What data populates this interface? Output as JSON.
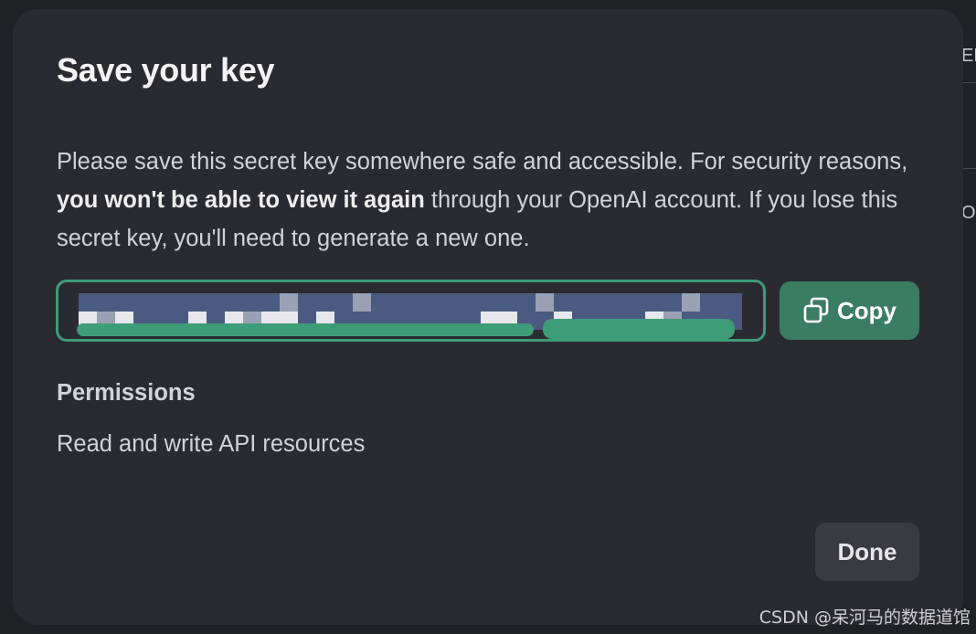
{
  "background": {
    "edge_glyph_top": "ED",
    "edge_glyph_mid": "O"
  },
  "dialog": {
    "title": "Save your key",
    "description_part1": "Please save this secret key somewhere safe and accessible. For security reasons, ",
    "description_bold": "you won't be able to view it again",
    "description_part2": " through your OpenAI account. If you lose this secret key, you'll need to generate a new one.",
    "key_field_value": "",
    "copy_button_label": "Copy",
    "copy_icon": "copy-icon",
    "permissions_heading": "Permissions",
    "permissions_value": "Read and write API resources",
    "done_button_label": "Done"
  },
  "colors": {
    "modal_bg": "#2a2b30",
    "accent_green": "#3f9c79",
    "copy_button_bg": "#3b7d63",
    "done_button_bg": "#3a3b41"
  },
  "watermark": "CSDN @呆河马的数据道馆"
}
